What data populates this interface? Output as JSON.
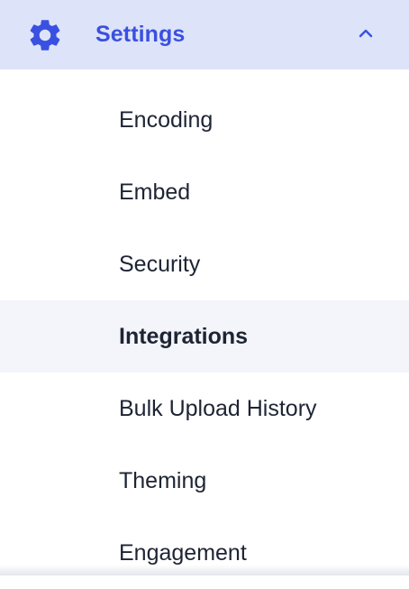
{
  "menu": {
    "header": {
      "title": "Settings",
      "icon": "gear-icon",
      "toggle_icon": "chevron-up-icon",
      "expanded": true,
      "accent_color": "#3a50e0",
      "background_color": "#dde3f9"
    },
    "items": [
      {
        "label": "Encoding",
        "active": false
      },
      {
        "label": "Embed",
        "active": false
      },
      {
        "label": "Security",
        "active": false
      },
      {
        "label": "Integrations",
        "active": true
      },
      {
        "label": "Bulk Upload History",
        "active": false
      },
      {
        "label": "Theming",
        "active": false
      },
      {
        "label": "Engagement",
        "active": false
      }
    ],
    "text_color": "#1d2433",
    "active_background_color": "#f4f5fa"
  }
}
